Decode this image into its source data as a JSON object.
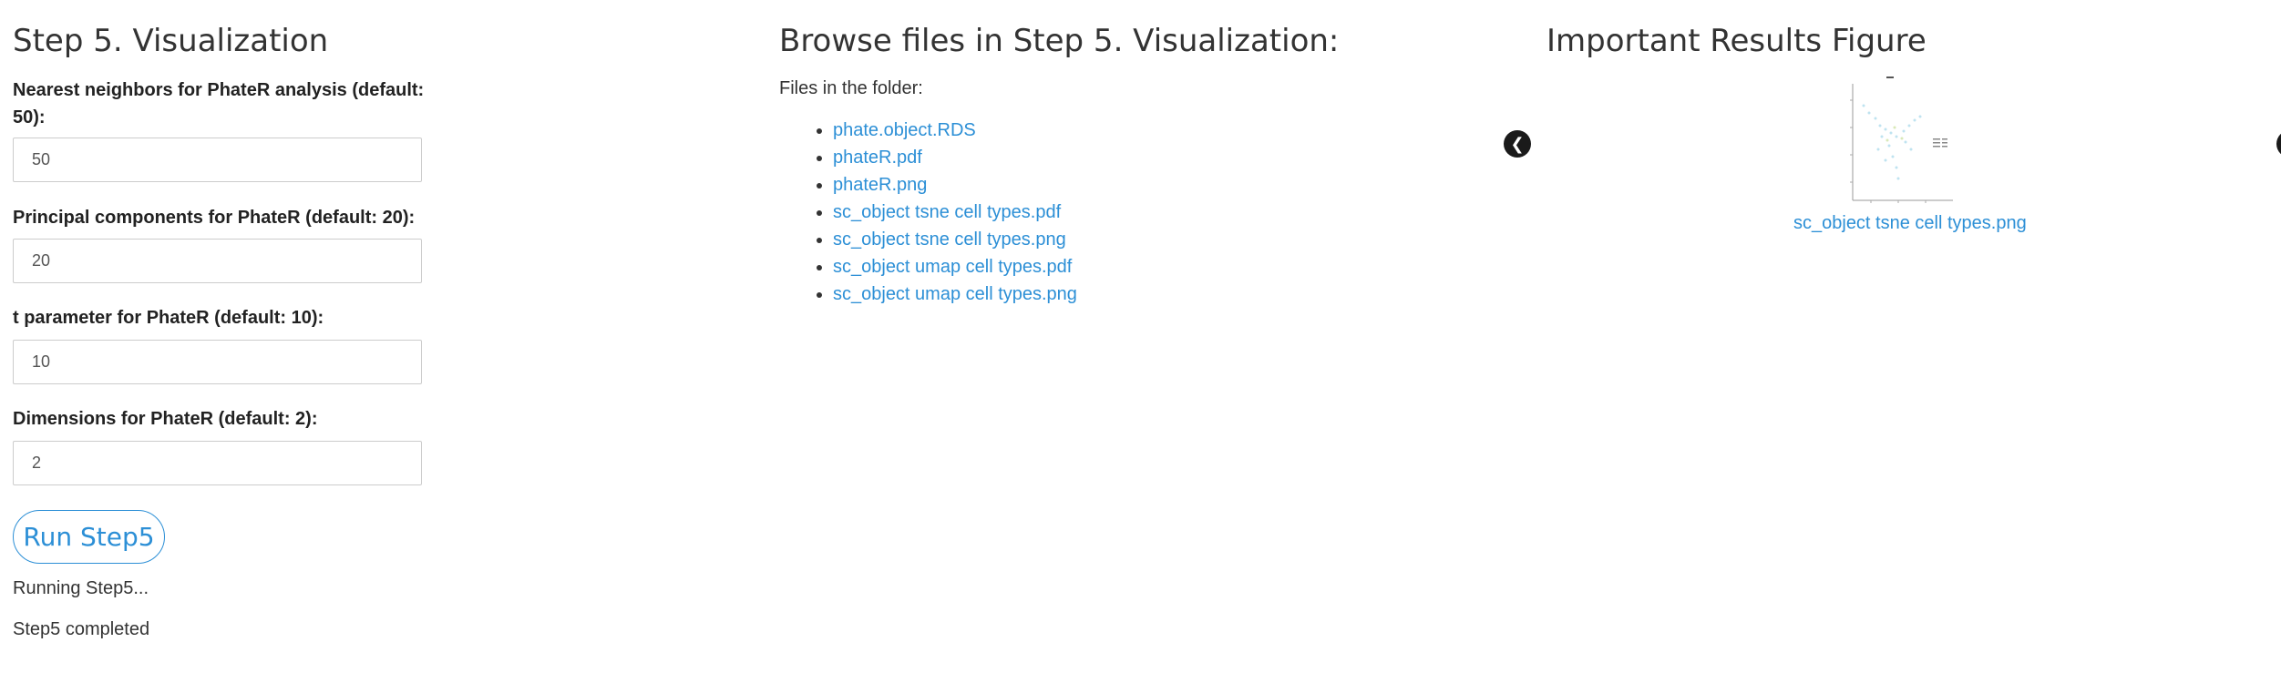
{
  "step_panel": {
    "title": "Step 5. Visualization",
    "params": [
      {
        "label": "Nearest neighbors for PhateR analysis (default: 50):",
        "value": "50"
      },
      {
        "label": "Principal components for PhateR (default: 20):",
        "value": "20"
      },
      {
        "label": "t parameter for PhateR (default: 10):",
        "value": "10"
      },
      {
        "label": "Dimensions for PhateR (default: 2):",
        "value": "2"
      }
    ],
    "run_label": "Run Step5",
    "status_running": "Running Step5...",
    "status_done": "Step5 completed"
  },
  "browser": {
    "title": "Browse files in Step 5. Visualization:",
    "files_label": "Files in the folder:",
    "files": [
      "phate.object.RDS",
      "phateR.pdf",
      "phateR.png",
      "sc_object tsne cell types.pdf",
      "sc_object tsne cell types.png",
      "sc_object umap cell types.pdf",
      "sc_object umap cell types.png"
    ]
  },
  "results": {
    "title": "Important Results Figure",
    "caption": "sc_object tsne cell types.png",
    "prev_icon": "chevron-left-icon"
  },
  "colors": {
    "link": "#2c8fd6",
    "text": "#333333"
  }
}
